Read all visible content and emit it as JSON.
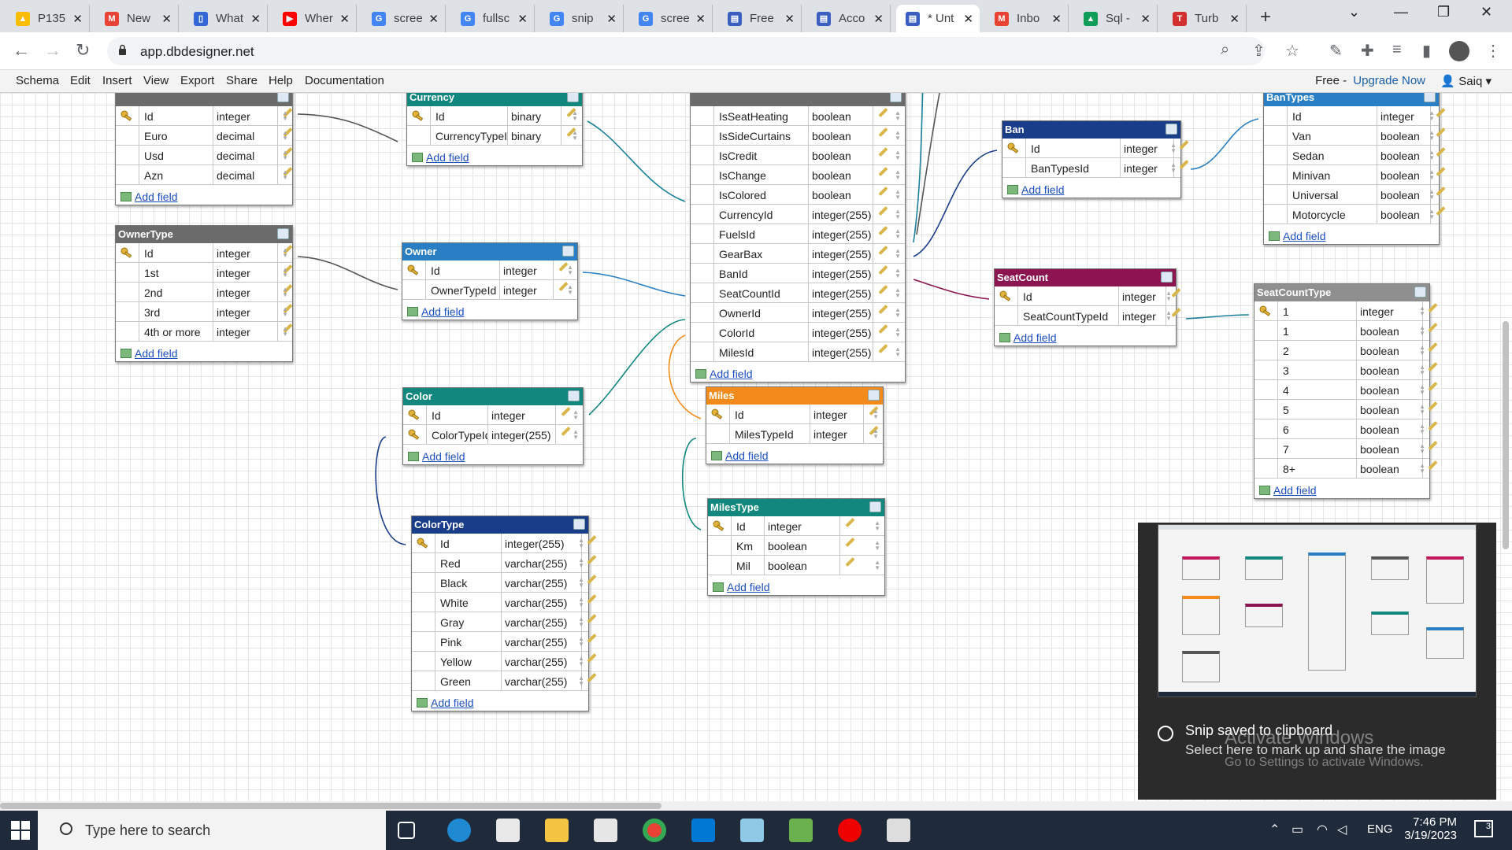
{
  "browser": {
    "tabs": [
      {
        "label": "P135",
        "color": "#fbbc04",
        "glyph": "▲"
      },
      {
        "label": "New",
        "color": "#ea4335",
        "glyph": "M"
      },
      {
        "label": "What",
        "color": "#3367d6",
        "glyph": "▯"
      },
      {
        "label": "Wher",
        "color": "#ff0000",
        "glyph": "▶"
      },
      {
        "label": "scree",
        "color": "#4285f4",
        "glyph": "G"
      },
      {
        "label": "fullsc",
        "color": "#4285f4",
        "glyph": "G"
      },
      {
        "label": "snip",
        "color": "#4285f4",
        "glyph": "G"
      },
      {
        "label": "scree",
        "color": "#4285f4",
        "glyph": "G"
      },
      {
        "label": "Free",
        "color": "#3b5fc0",
        "glyph": "▤"
      },
      {
        "label": "Acco",
        "color": "#3b5fc0",
        "glyph": "▤"
      },
      {
        "label": "* Unt",
        "color": "#3b5fc0",
        "glyph": "▤"
      },
      {
        "label": "Inbo",
        "color": "#ea4335",
        "glyph": "M"
      },
      {
        "label": "Sql -",
        "color": "#0f9d58",
        "glyph": "▲"
      },
      {
        "label": "Turb",
        "color": "#d32f2f",
        "glyph": "T"
      }
    ],
    "url": "app.dbdesigner.net"
  },
  "menu": {
    "items": [
      "Schema",
      "Edit",
      "Insert",
      "View",
      "Export",
      "Share",
      "Help",
      "Documentation"
    ],
    "plan": "Free - ",
    "upgrade": "Upgrade Now",
    "user": "Saiq"
  },
  "add_field_label": "Add field",
  "tables": [
    {
      "name": "",
      "color": "#6b6b6b",
      "fields": [
        {
          "name": "Id",
          "type": "integer",
          "key": true
        },
        {
          "name": "Euro",
          "type": "decimal"
        },
        {
          "name": "Usd",
          "type": "decimal"
        },
        {
          "name": "Azn",
          "type": "decimal"
        }
      ]
    },
    {
      "name": "Currency",
      "color": "#12877e",
      "fields": [
        {
          "name": "Id",
          "type": "binary",
          "key": true
        },
        {
          "name": "CurrencyTypeId",
          "type": "binary"
        }
      ]
    },
    {
      "name": "",
      "color": "#6b6b6b",
      "fields": [
        {
          "name": "IsSeatHeating",
          "type": "boolean"
        },
        {
          "name": "IsSideCurtains",
          "type": "boolean"
        },
        {
          "name": "IsCredit",
          "type": "boolean"
        },
        {
          "name": "IsChange",
          "type": "boolean"
        },
        {
          "name": "IsColored",
          "type": "boolean"
        },
        {
          "name": "CurrencyId",
          "type": "integer(255)"
        },
        {
          "name": "FuelsId",
          "type": "integer(255)"
        },
        {
          "name": "GearBax",
          "type": "integer(255)"
        },
        {
          "name": "BanId",
          "type": "integer(255)"
        },
        {
          "name": "SeatCountId",
          "type": "integer(255)"
        },
        {
          "name": "OwnerId",
          "type": "integer(255)"
        },
        {
          "name": "ColorId",
          "type": "integer(255)"
        },
        {
          "name": "MilesId",
          "type": "integer(255)"
        }
      ]
    },
    {
      "name": "Ban",
      "color": "#1a3d8a",
      "fields": [
        {
          "name": "Id",
          "type": "integer",
          "key": true
        },
        {
          "name": "BanTypesId",
          "type": "integer"
        }
      ]
    },
    {
      "name": "BanTypes",
      "color": "#2a7fc4",
      "fields": [
        {
          "name": "Id",
          "type": "integer"
        },
        {
          "name": "Van",
          "type": "boolean"
        },
        {
          "name": "Sedan",
          "type": "boolean"
        },
        {
          "name": "Minivan",
          "type": "boolean"
        },
        {
          "name": "Universal",
          "type": "boolean"
        },
        {
          "name": "Motorcycle",
          "type": "boolean"
        }
      ]
    },
    {
      "name": "OwnerType",
      "color": "#6b6b6b",
      "fields": [
        {
          "name": "Id",
          "type": "integer",
          "key": true
        },
        {
          "name": "1st",
          "type": "integer"
        },
        {
          "name": "2nd",
          "type": "integer"
        },
        {
          "name": "3rd",
          "type": "integer"
        },
        {
          "name": "4th or more",
          "type": "integer"
        }
      ]
    },
    {
      "name": "Owner",
      "color": "#2a7fc4",
      "fields": [
        {
          "name": "Id",
          "type": "integer",
          "key": true
        },
        {
          "name": "OwnerTypeId",
          "type": "integer"
        }
      ]
    },
    {
      "name": "SeatCount",
      "color": "#8b1451",
      "fields": [
        {
          "name": "Id",
          "type": "integer",
          "key": true
        },
        {
          "name": "SeatCountTypeId",
          "type": "integer"
        }
      ]
    },
    {
      "name": "SeatCountType",
      "color": "#8f8f8f",
      "fields": [
        {
          "name": "1",
          "type": "integer",
          "key": true
        },
        {
          "name": "1",
          "type": "boolean"
        },
        {
          "name": "2",
          "type": "boolean"
        },
        {
          "name": "3",
          "type": "boolean"
        },
        {
          "name": "4",
          "type": "boolean"
        },
        {
          "name": "5",
          "type": "boolean"
        },
        {
          "name": "6",
          "type": "boolean"
        },
        {
          "name": "7",
          "type": "boolean"
        },
        {
          "name": "8+",
          "type": "boolean"
        }
      ]
    },
    {
      "name": "Color",
      "color": "#12877e",
      "fields": [
        {
          "name": "Id",
          "type": "integer",
          "key": true
        },
        {
          "name": "ColorTypeId",
          "type": "integer(255)",
          "key": true
        }
      ]
    },
    {
      "name": "Miles",
      "color": "#f28a1c",
      "fields": [
        {
          "name": "Id",
          "type": "integer",
          "key": true
        },
        {
          "name": "MilesTypeId",
          "type": "integer"
        }
      ]
    },
    {
      "name": "ColorType",
      "color": "#1a3d8a",
      "fields": [
        {
          "name": "Id",
          "type": "integer(255)",
          "key": true
        },
        {
          "name": "Red",
          "type": "varchar(255)"
        },
        {
          "name": "Black",
          "type": "varchar(255)"
        },
        {
          "name": "White",
          "type": "varchar(255)"
        },
        {
          "name": "Gray",
          "type": "varchar(255)"
        },
        {
          "name": "Pink",
          "type": "varchar(255)"
        },
        {
          "name": "Yellow",
          "type": "varchar(255)"
        },
        {
          "name": "Green",
          "type": "varchar(255)"
        }
      ]
    },
    {
      "name": "MilesType",
      "color": "#12877e",
      "fields": [
        {
          "name": "Id",
          "type": "integer",
          "key": true
        },
        {
          "name": "Km",
          "type": "boolean"
        },
        {
          "name": "Mil",
          "type": "boolean"
        }
      ]
    }
  ],
  "notification": {
    "title": "Snip saved to clipboard",
    "body": "Select here to mark up and share the image"
  },
  "watermark": {
    "title": "Activate Windows",
    "body": "Go to Settings to activate Windows."
  },
  "taskbar": {
    "search_placeholder": "Type here to search",
    "language": "ENG",
    "time": "7:46 PM",
    "date": "3/19/2023",
    "notif_count": "3"
  }
}
